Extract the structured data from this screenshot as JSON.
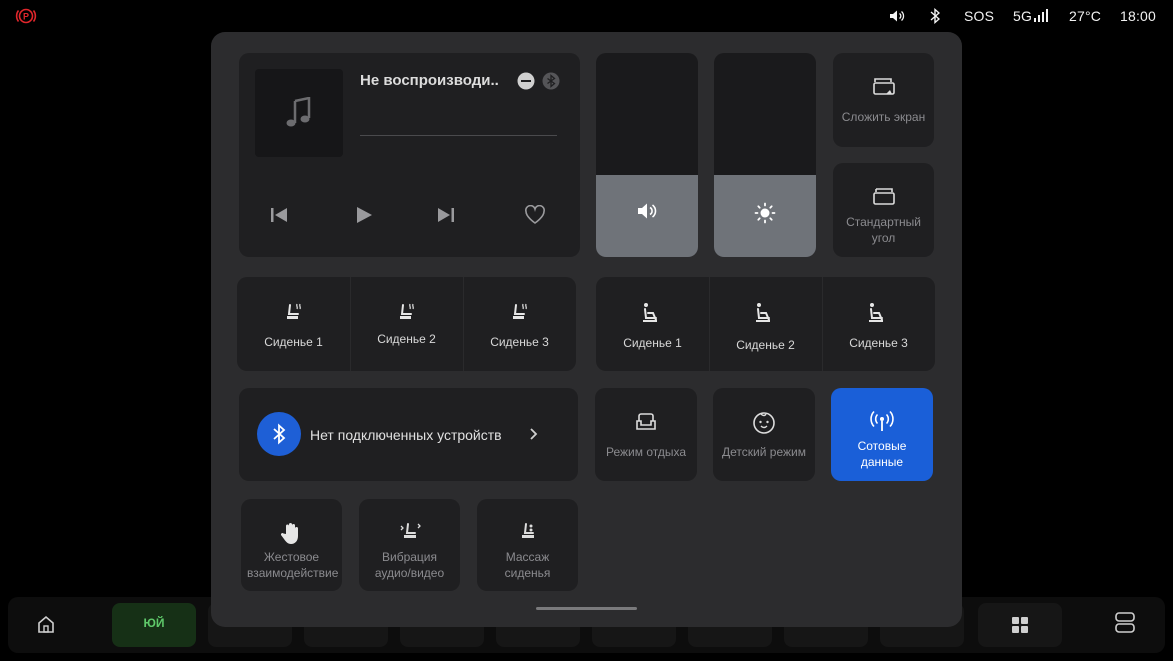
{
  "status_bar": {
    "volume_icon": "volume-icon",
    "bluetooth_icon": "bluetooth-icon",
    "sos": "SOS",
    "network": "5G",
    "temperature": "27°C",
    "time": "18:00",
    "parking_brake_color": "#e0262b"
  },
  "media": {
    "title": "Не воспроизводи..",
    "controls": [
      "previous-icon",
      "play-icon",
      "next-icon",
      "heart-icon"
    ]
  },
  "quick_tiles": {
    "split_screen": "Сложить экран",
    "standard_angle": "Стандартный угол"
  },
  "seats_left": [
    {
      "label": "Сиденье 1"
    },
    {
      "label": "Сиденье 2"
    },
    {
      "label": "Сиденье 3"
    }
  ],
  "seats_right": [
    {
      "label": "Сиденье 1"
    },
    {
      "label": "Сиденье 2"
    },
    {
      "label": "Сиденье 3"
    }
  ],
  "bluetooth": {
    "status": "Нет подключенных устройств"
  },
  "modes": {
    "rest": "Режим отдыха",
    "child": "Детский режим",
    "cellular": "Сотовые данные"
  },
  "features": {
    "gesture": "Жестовое взаимодействие",
    "vibration": "Вибрация аудио/видео",
    "massage": "Массаж сиденья"
  },
  "colors": {
    "accent": "#1a5fd8",
    "bluetooth_circle": "#1e5fd6",
    "slider_fill": "#6f7379"
  },
  "dock": {
    "app_label": "ЮЙ"
  }
}
